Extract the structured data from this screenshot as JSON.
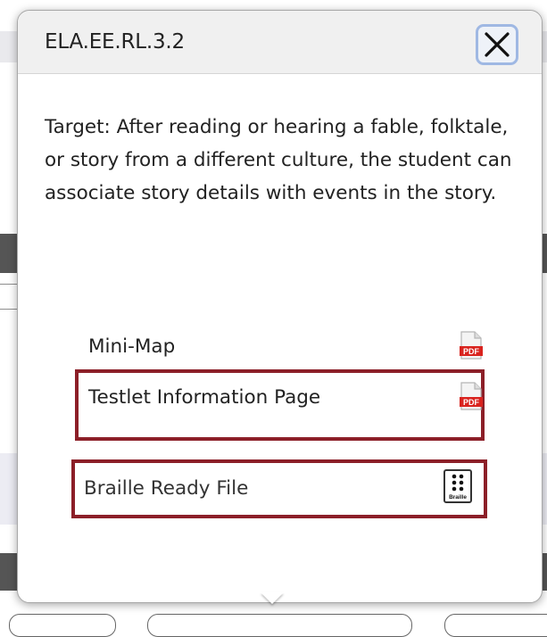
{
  "popup": {
    "title": "ELA.EE.RL.3.2",
    "close_icon": "close-icon",
    "target_text": "Target: After reading or hearing a fable, folktale, or story from a different culture, the student can associate story details with events in the story."
  },
  "resources": [
    {
      "label": "Mini-Map",
      "icon": "pdf-icon"
    },
    {
      "label": "Testlet Information Page",
      "icon": "pdf-icon"
    },
    {
      "label": "Braille Ready File",
      "icon": "braille-icon"
    }
  ],
  "icons": {
    "pdf_text": "PDF",
    "braille_text": "Braille"
  },
  "colors": {
    "highlight_border": "#8c1f28",
    "close_focus_ring": "#9fb8e3",
    "pdf_red": "#d9231e"
  }
}
